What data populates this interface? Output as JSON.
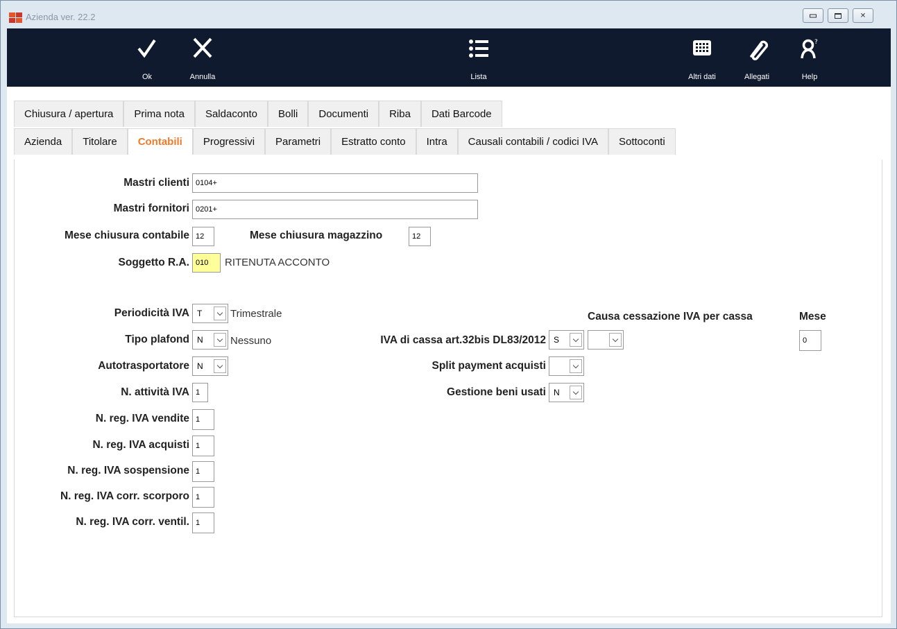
{
  "window": {
    "title": "Azienda ver. 22.2"
  },
  "toolbar": {
    "ok": {
      "label": "Ok",
      "key": "O"
    },
    "annulla": {
      "label": "Annulla",
      "key": "A"
    },
    "lista": {
      "label": "Lista",
      "key": "i"
    },
    "altri_dati": {
      "label": "Altri dati",
      "key": "d"
    },
    "allegati": {
      "label": "Allegati"
    },
    "help": {
      "label": "Help",
      "key": "H"
    }
  },
  "tabs_row1": [
    {
      "label": "Chiusura / apertura",
      "key": "h"
    },
    {
      "label": "Prima nota",
      "key": "r"
    },
    {
      "label": "Saldaconto",
      "key": "l"
    },
    {
      "label": "Bolli",
      "key": "B"
    },
    {
      "label": "Documenti",
      "key": "D"
    },
    {
      "label": "Riba",
      "key": "R"
    },
    {
      "label": "Dati Barcode",
      "key": "D"
    }
  ],
  "tabs_row2": [
    {
      "label": "Azienda",
      "key": "A"
    },
    {
      "label": "Titolare",
      "key": "T"
    },
    {
      "label": "Contabili",
      "key": "C",
      "active": true
    },
    {
      "label": "Progressivi",
      "key": "P"
    },
    {
      "label": "Parametri",
      "key": "m"
    },
    {
      "label": "Estratto conto",
      "key": "E"
    },
    {
      "label": "Intra",
      "key": "I"
    },
    {
      "label": "Causali contabili / codici IVA",
      "key": "u"
    },
    {
      "label": "Sottoconti",
      "key": "S"
    }
  ],
  "form": {
    "mastri_clienti": {
      "label": "Mastri clienti",
      "value": "0104+"
    },
    "mastri_fornitori": {
      "label": "Mastri fornitori",
      "value": "0201+"
    },
    "mese_chiusura_contabile": {
      "label": "Mese chiusura contabile",
      "value": "12"
    },
    "mese_chiusura_magazzino": {
      "label": "Mese chiusura magazzino",
      "value": "12"
    },
    "soggetto_ra": {
      "label": "Soggetto R.A.",
      "value": "010",
      "desc": "RITENUTA ACCONTO"
    },
    "periodicita_iva": {
      "label": "Periodicità IVA",
      "value": "T",
      "desc": "Trimestrale"
    },
    "tipo_plafond": {
      "label": "Tipo plafond",
      "value": "N",
      "desc": "Nessuno"
    },
    "autotrasportatore": {
      "label": "Autotrasportatore",
      "value": "N"
    },
    "n_attivita_iva": {
      "label": "N. attività IVA",
      "value": "1"
    },
    "n_reg_vendite": {
      "label": "N. reg. IVA vendite",
      "value": "1"
    },
    "n_reg_acquisti": {
      "label": "N. reg. IVA acquisti",
      "value": "1"
    },
    "n_reg_sospensione": {
      "label": "N. reg. IVA sospensione",
      "value": "1"
    },
    "n_reg_scorporo": {
      "label": "N. reg. IVA corr. scorporo",
      "value": "1"
    },
    "n_reg_ventil": {
      "label": "N. reg. IVA corr. ventil.",
      "value": "1"
    },
    "iva_cassa": {
      "label": "IVA di cassa art.32bis DL83/2012",
      "value": "S"
    },
    "causa_cessazione": {
      "label": "Causa cessazione IVA per cassa",
      "value": ""
    },
    "mese": {
      "label": "Mese",
      "value": "0"
    },
    "split_payment": {
      "label": "Split payment acquisti",
      "value": ""
    },
    "beni_usati": {
      "label": "Gestione beni usati",
      "value": "N"
    }
  },
  "colors": {
    "toolbar_bg": "#101a2e",
    "active_tab": "#f07a2b",
    "yellow_field": "#ffff99"
  }
}
